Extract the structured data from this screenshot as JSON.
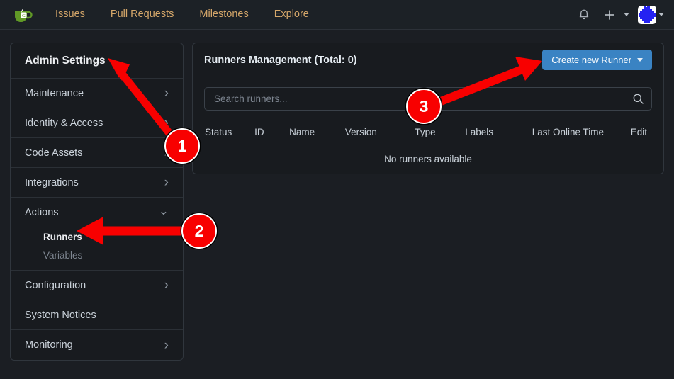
{
  "navbar": {
    "logo_icon": "gitea-teacup-logo",
    "links": [
      {
        "label": "Issues"
      },
      {
        "label": "Pull Requests"
      },
      {
        "label": "Milestones"
      },
      {
        "label": "Explore"
      }
    ],
    "notification_icon": "bell-icon",
    "create_icon": "plus-icon",
    "create_caret_icon": "chevron-down-icon",
    "avatar_icon": "user-avatar-identicon",
    "avatar_caret_icon": "chevron-down-icon"
  },
  "sidebar": {
    "title": "Admin Settings",
    "items": [
      {
        "label": "Maintenance",
        "chevron": "right"
      },
      {
        "label": "Identity & Access",
        "chevron": "right"
      },
      {
        "label": "Code Assets",
        "chevron": "right"
      },
      {
        "label": "Integrations",
        "chevron": "right"
      },
      {
        "label": "Actions",
        "chevron": "down"
      }
    ],
    "actions_children": [
      {
        "label": "Runners",
        "active": true
      },
      {
        "label": "Variables",
        "active": false
      }
    ],
    "items_after": [
      {
        "label": "Configuration",
        "chevron": "right"
      },
      {
        "label": "System Notices",
        "chevron": "none"
      },
      {
        "label": "Monitoring",
        "chevron": "right"
      }
    ]
  },
  "main": {
    "title": "Runners Management (Total: 0)",
    "create_button": "Create new Runner",
    "create_button_color": "#3a83c3",
    "search_placeholder": "Search runners...",
    "search_value": "",
    "search_icon": "magnifier-icon",
    "table": {
      "columns": [
        "Status",
        "ID",
        "Name",
        "Version",
        "Type",
        "Labels",
        "Last Online Time",
        "Edit"
      ],
      "rows": [],
      "empty_message": "No runners available"
    }
  },
  "annotations": {
    "color": "#f80000",
    "badges": [
      {
        "number": "1"
      },
      {
        "number": "2"
      },
      {
        "number": "3"
      }
    ]
  }
}
